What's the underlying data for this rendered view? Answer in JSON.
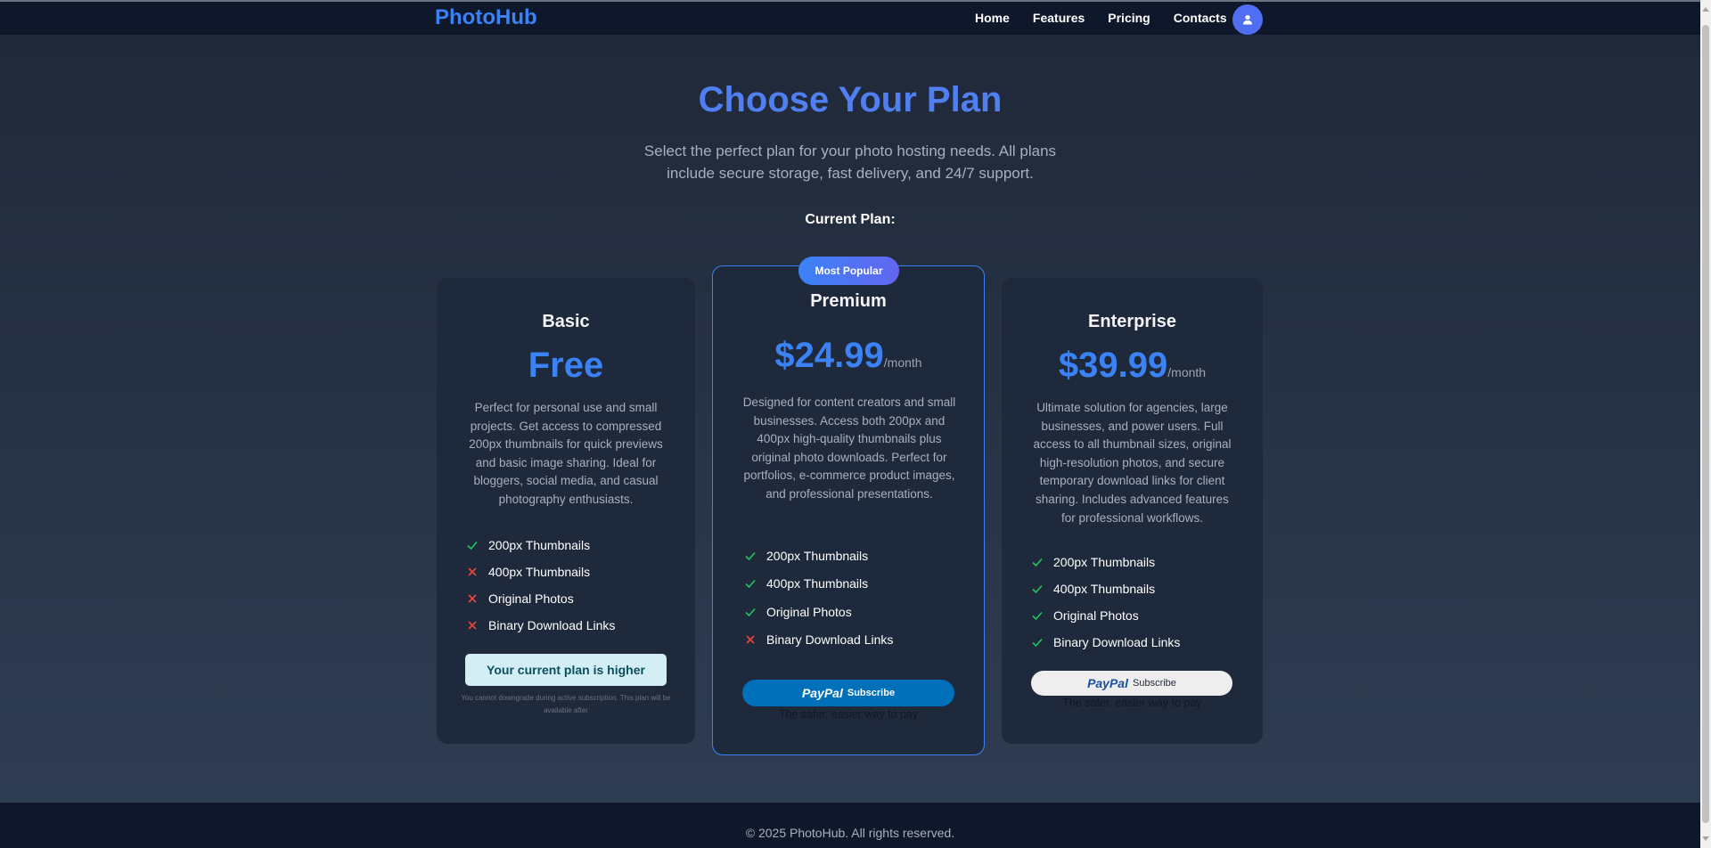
{
  "nav": {
    "brand": "PhotoHub",
    "links": [
      "Home",
      "Features",
      "Pricing",
      "Contacts"
    ],
    "avatar_icon": "user-icon"
  },
  "hero": {
    "title": "Choose Your Plan",
    "subtitle": "Select the perfect plan for your photo hosting needs. All plans include secure storage, fast delivery, and 24/7 support.",
    "current_plan_label": "Current Plan:"
  },
  "plans": {
    "basic": {
      "name": "Basic",
      "price": "Free",
      "description": "Perfect for personal use and small projects. Get access to compressed 200px thumbnails for quick previews and basic image sharing. Ideal for bloggers, social media, and casual photography enthusiasts.",
      "features": [
        {
          "label": "200px Thumbnails",
          "included": true
        },
        {
          "label": "400px Thumbnails",
          "included": false
        },
        {
          "label": "Original Photos",
          "included": false
        },
        {
          "label": "Binary Download Links",
          "included": false
        }
      ],
      "button_label": "Your current plan is higher",
      "note": "You cannot downgrade during active subscription. This plan will be available after"
    },
    "premium": {
      "badge": "Most Popular",
      "name": "Premium",
      "price": "$24.99",
      "period": "/month",
      "description": "Designed for content creators and small businesses. Access both 200px and 400px high-quality thumbnails plus original photo downloads. Perfect for portfolios, e-commerce product images, and professional presentations.",
      "features": [
        {
          "label": "200px Thumbnails",
          "included": true
        },
        {
          "label": "400px Thumbnails",
          "included": true
        },
        {
          "label": "Original Photos",
          "included": true
        },
        {
          "label": "Binary Download Links",
          "included": false
        }
      ],
      "paypal_logo": "PayPal",
      "paypal_action": "Subscribe",
      "tagline": "The safer, easier way to pay"
    },
    "enterprise": {
      "name": "Enterprise",
      "price": "$39.99",
      "period": "/month",
      "description": "Ultimate solution for agencies, large businesses, and power users. Full access to all thumbnail sizes, original high-resolution photos, and secure temporary download links for client sharing. Includes advanced features for professional workflows.",
      "features": [
        {
          "label": "200px Thumbnails",
          "included": true
        },
        {
          "label": "400px Thumbnails",
          "included": true
        },
        {
          "label": "Original Photos",
          "included": true
        },
        {
          "label": "Binary Download Links",
          "included": true
        }
      ],
      "paypal_logo": "PayPal",
      "paypal_action": "Subscribe",
      "tagline": "The safer, easier way to pay"
    }
  },
  "footer": {
    "text": "© 2025 PhotoHub. All rights reserved."
  },
  "colors": {
    "accent": "#3b82f6",
    "check": "#22c55e",
    "cross": "#ef4444",
    "paypal_blue": "#0070ba"
  }
}
